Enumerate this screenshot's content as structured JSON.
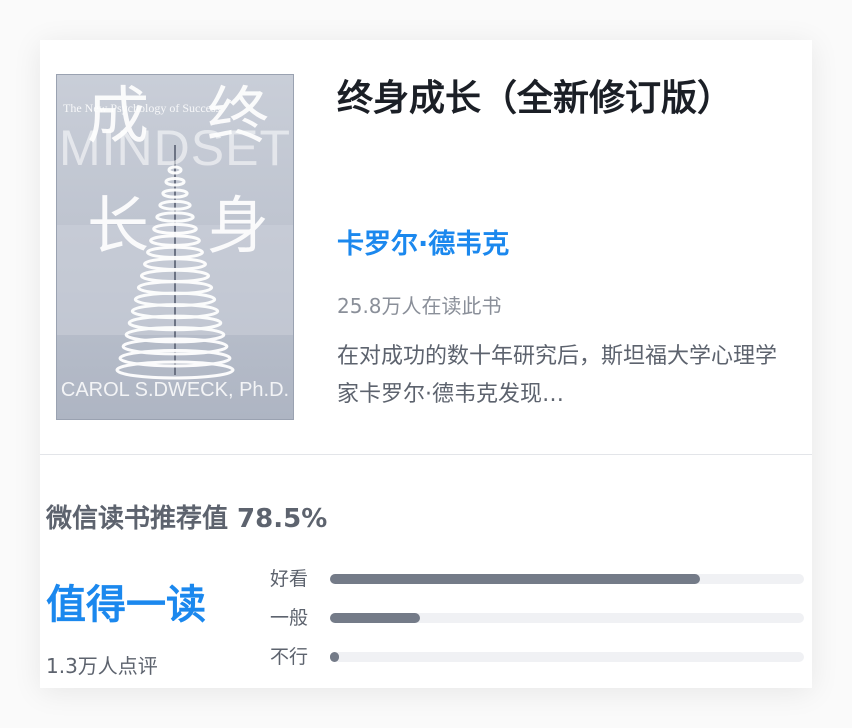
{
  "book": {
    "title": "终身成长（全新修订版）",
    "author": "卡罗尔·德韦克",
    "readers": "25.8万人在读此书",
    "description": "在对成功的数十年研究后，斯坦福大学心理学家卡罗尔·德韦克发现…",
    "cover": {
      "subtitle": "The New Psychology of Success",
      "title_en": "MINDSET",
      "title_cn_left": [
        "成",
        "长"
      ],
      "title_cn_right": [
        "终",
        "身"
      ],
      "author_en": "CAROL S.DWECK, Ph.D."
    }
  },
  "recommendation": {
    "label": "微信读书推荐值 78.5%",
    "verdict": "值得一读",
    "review_count": "1.3万人点评",
    "ratings": [
      {
        "label": "好看",
        "fraction": 0.78
      },
      {
        "label": "一般",
        "fraction": 0.19
      },
      {
        "label": "不行",
        "fraction": 0.02
      }
    ]
  },
  "colors": {
    "accent": "#1b88ee",
    "bar_fill": "#747b88",
    "bar_track": "#f0f1f4"
  }
}
